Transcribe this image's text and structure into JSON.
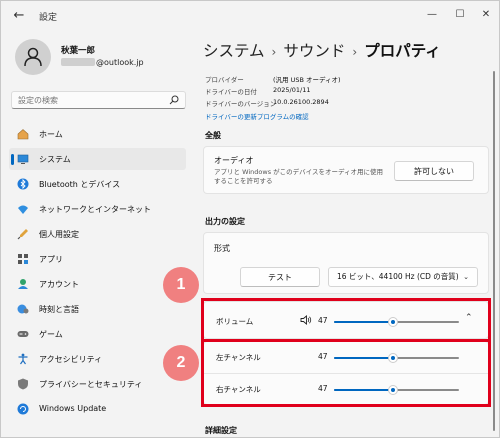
{
  "window": {
    "title": "設定"
  },
  "user": {
    "name": "秋葉一郎",
    "email_suffix": "@outlook.jp"
  },
  "search": {
    "placeholder": "設定の検索"
  },
  "sidebar": {
    "items": [
      {
        "label": "ホーム",
        "icon": "home-icon"
      },
      {
        "label": "システム",
        "icon": "system-icon",
        "selected": true
      },
      {
        "label": "Bluetooth とデバイス",
        "icon": "bluetooth-icon"
      },
      {
        "label": "ネットワークとインターネット",
        "icon": "network-icon"
      },
      {
        "label": "個人用設定",
        "icon": "personalization-icon"
      },
      {
        "label": "アプリ",
        "icon": "apps-icon"
      },
      {
        "label": "アカウント",
        "icon": "account-icon"
      },
      {
        "label": "時刻と言語",
        "icon": "time-language-icon"
      },
      {
        "label": "ゲーム",
        "icon": "gaming-icon"
      },
      {
        "label": "アクセシビリティ",
        "icon": "accessibility-icon"
      },
      {
        "label": "プライバシーとセキュリティ",
        "icon": "privacy-shield-icon"
      },
      {
        "label": "Windows Update",
        "icon": "windows-update-icon"
      }
    ]
  },
  "breadcrumb": {
    "level1": "システム",
    "sep": "›",
    "level2": "サウンド",
    "current": "プロパティ"
  },
  "properties": {
    "provider_label": "プロバイダー",
    "provider_value": "(汎用 USB オーディオ)",
    "date_label": "ドライバーの日付",
    "date_value": "2025/01/11",
    "version_label": "ドライバーのバージョン",
    "version_value": "10.0.26100.2894",
    "update_link": "ドライバーの更新プログラムの確認"
  },
  "general": {
    "heading": "全般",
    "audio_title": "オーディオ",
    "audio_desc": "アプリと Windows がこのデバイスをオーディオ用に使用することを許可する",
    "disallow_button": "許可しない"
  },
  "output": {
    "heading": "出力の設定",
    "format_label": "形式",
    "test_button": "テスト",
    "format_value": "16 ビット、44100 Hz (CD の音質)",
    "volume_label": "ボリューム",
    "volume_value": "47",
    "left_label": "左チャンネル",
    "left_value": "47",
    "right_label": "右チャンネル",
    "right_value": "47"
  },
  "advanced": {
    "heading": "詳細設定"
  },
  "annotations": {
    "badge1": "1",
    "badge2": "2"
  },
  "colors": {
    "accent": "#0067c0",
    "highlight": "#e0001b",
    "badge": "#f08080"
  }
}
